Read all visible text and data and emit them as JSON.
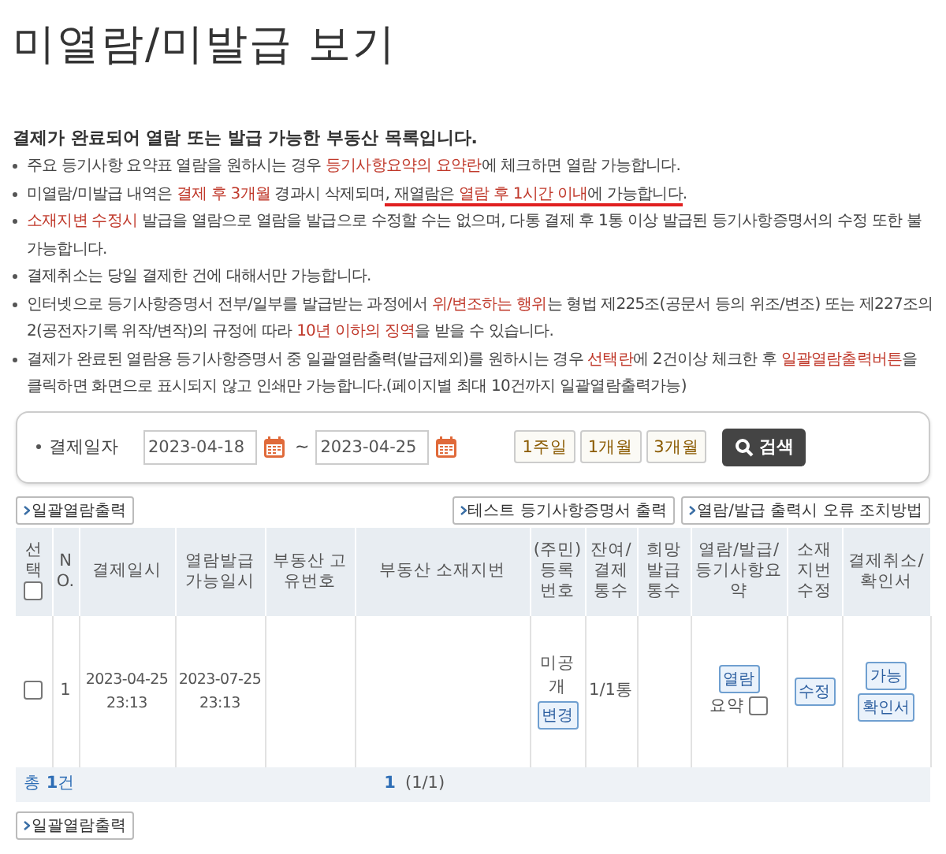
{
  "title": "미열람/미발급 보기",
  "notice": {
    "intro": "결제가 완료되어 열람 또는 발급 가능한 부동산 목록입니다.",
    "items": [
      {
        "segments": [
          {
            "text": "주요 등기사항 요약표 열람을 원하시는 경우 ",
            "highlight": false,
            "underline": false
          },
          {
            "text": "등기사항요약의 요약란",
            "highlight": true,
            "underline": false
          },
          {
            "text": "에 체크하면 열람 가능합니다.",
            "highlight": false,
            "underline": false
          }
        ]
      },
      {
        "segments": [
          {
            "text": "미열람/미발급 내역은 ",
            "highlight": false,
            "underline": false
          },
          {
            "text": "결제 후 3개월",
            "highlight": true,
            "underline": false
          },
          {
            "text": " 경과시 삭제되며",
            "highlight": false,
            "underline": false
          },
          {
            "text": ", 재열람은 ",
            "highlight": false,
            "underline": true
          },
          {
            "text": "열람 후 1시간 이내",
            "highlight": true,
            "underline": true
          },
          {
            "text": "에 가능합니다",
            "highlight": false,
            "underline": true
          },
          {
            "text": ".",
            "highlight": false,
            "underline": false
          }
        ]
      },
      {
        "segments": [
          {
            "text": "소재지변 수정시",
            "highlight": true,
            "underline": false
          },
          {
            "text": " 발급을 열람으로 열람을 발급으로 수정할 수는 없으며, 다통 결제 후 1통 이상 발급된 등기사항증명서의 수정 또한 불가능합니다.",
            "highlight": false,
            "underline": false
          }
        ]
      },
      {
        "segments": [
          {
            "text": "결제취소는 당일 결제한 건에 대해서만 가능합니다.",
            "highlight": false,
            "underline": false
          }
        ]
      },
      {
        "segments": [
          {
            "text": "인터넷으로 등기사항증명서 전부/일부를 발급받는 과정에서 ",
            "highlight": false,
            "underline": false
          },
          {
            "text": "위/변조하는 행위",
            "highlight": true,
            "underline": false
          },
          {
            "text": "는 형법 제225조(공문서 등의 위조/변조) 또는 제227조의 2(공전자기록 위작/변작)의 규정에 따라 ",
            "highlight": false,
            "underline": false
          },
          {
            "text": "10년 이하의 징역",
            "highlight": true,
            "underline": false
          },
          {
            "text": "을 받을 수 있습니다.",
            "highlight": false,
            "underline": false
          }
        ]
      },
      {
        "segments": [
          {
            "text": "결제가 완료된 열람용 등기사항증명서 중 일괄열람출력(발급제외)를 원하시는 경우 ",
            "highlight": false,
            "underline": false
          },
          {
            "text": "선택란",
            "highlight": true,
            "underline": false
          },
          {
            "text": "에 2건이상 체크한 후 ",
            "highlight": false,
            "underline": false
          },
          {
            "text": "일괄열람출력버튼",
            "highlight": true,
            "underline": false
          },
          {
            "text": "을 클릭하면 화면으로 표시되지 않고 인쇄만 가능합니다.(페이지별 최대 10건까지 일괄열람출력가능)",
            "highlight": false,
            "underline": false
          }
        ]
      }
    ]
  },
  "search": {
    "label": "결제일자",
    "from": "2023-04-18",
    "separator": "~",
    "to": "2023-04-25",
    "periods": [
      "1주일",
      "1개월",
      "3개월"
    ],
    "button": "검색"
  },
  "toolbar": {
    "left": "일괄열람출력",
    "right": [
      "테스트 등기사항증명서 출력",
      "열람/발급 출력시 오류 조치방법"
    ]
  },
  "table": {
    "columns": [
      "선택",
      "NO.",
      "결제일시",
      "열람발급가능일시",
      "부동산 고유번호",
      "부동산 소재지번",
      "(주민)등록번호",
      "잔여/결제통수",
      "희망발급통수",
      "열람/발급/등기사항요약",
      "소재지번수정",
      "결제취소/확인서"
    ],
    "header_checked": false,
    "rows": [
      {
        "checked": false,
        "no": "1",
        "paid_at": "2023-04-25 23:13",
        "available_until": "2023-07-25 23:13",
        "registration": "미공개",
        "registration_button": "변경",
        "remaining": "1/1통",
        "view_button": "열람",
        "summary_label": "요약",
        "summary_checked": false,
        "edit_button": "수정",
        "cancel_button": "가능",
        "certificate_button": "확인서"
      }
    ],
    "total": "총 **1**건",
    "page": "1",
    "page_info": "(1/1)"
  },
  "bottom_button": "일괄열람출력"
}
